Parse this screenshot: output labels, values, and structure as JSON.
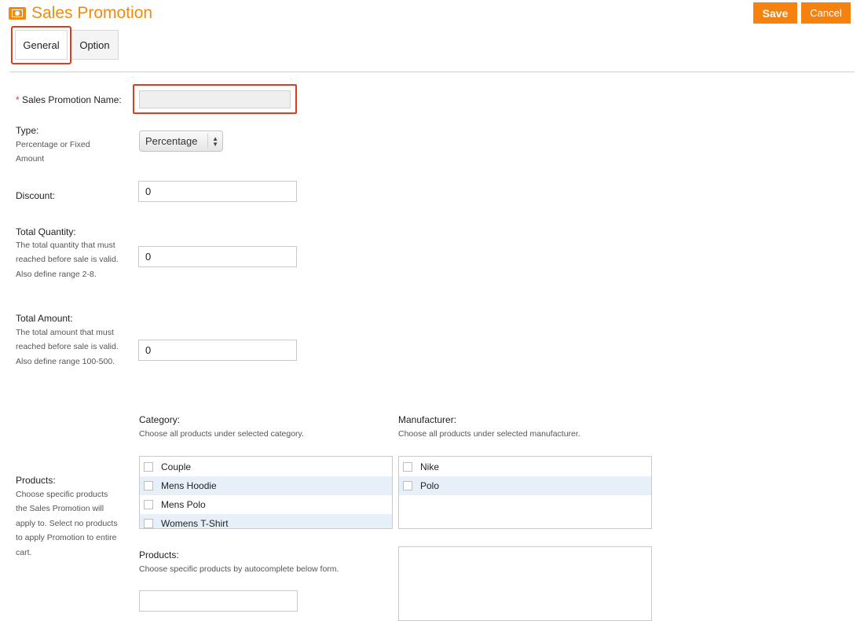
{
  "header": {
    "icon": "money-icon",
    "title": "Sales Promotion",
    "save_label": "Save",
    "cancel_label": "Cancel",
    "accent_color": "#f5820f"
  },
  "tabs": [
    {
      "label": "General",
      "active": true
    },
    {
      "label": "Option",
      "active": false
    }
  ],
  "form": {
    "name": {
      "required_mark": "*",
      "label": "Sales Promotion Name:",
      "value": ""
    },
    "type": {
      "label": "Type:",
      "help": "Percentage or Fixed Amount",
      "selected": "Percentage"
    },
    "discount": {
      "label": "Discount:",
      "value": "0"
    },
    "total_quantity": {
      "label": "Total Quantity:",
      "help1": "The total quantity that must reached before sale is valid.",
      "help2": "Also define range 2-8.",
      "value": "0"
    },
    "total_amount": {
      "label": "Total Amount:",
      "help1": "The total amount that must reached before sale is valid.",
      "help2": "Also define range 100-500.",
      "value": "0"
    },
    "products_section": {
      "label": "Products:",
      "help": "Choose specific products the Sales Promotion will apply to. Select no products to apply Promotion to entire cart."
    },
    "category": {
      "label": "Category:",
      "help": "Choose all products under selected category.",
      "items": [
        "Couple",
        "Mens Hoodie",
        "Mens Polo",
        "Womens T-Shirt"
      ]
    },
    "manufacturer": {
      "label": "Manufacturer:",
      "help": "Choose all products under selected manufacturer.",
      "items": [
        "Nike",
        "Polo"
      ]
    },
    "products": {
      "label": "Products:",
      "help": "Choose specific products by autocomplete below form.",
      "value": ""
    }
  }
}
